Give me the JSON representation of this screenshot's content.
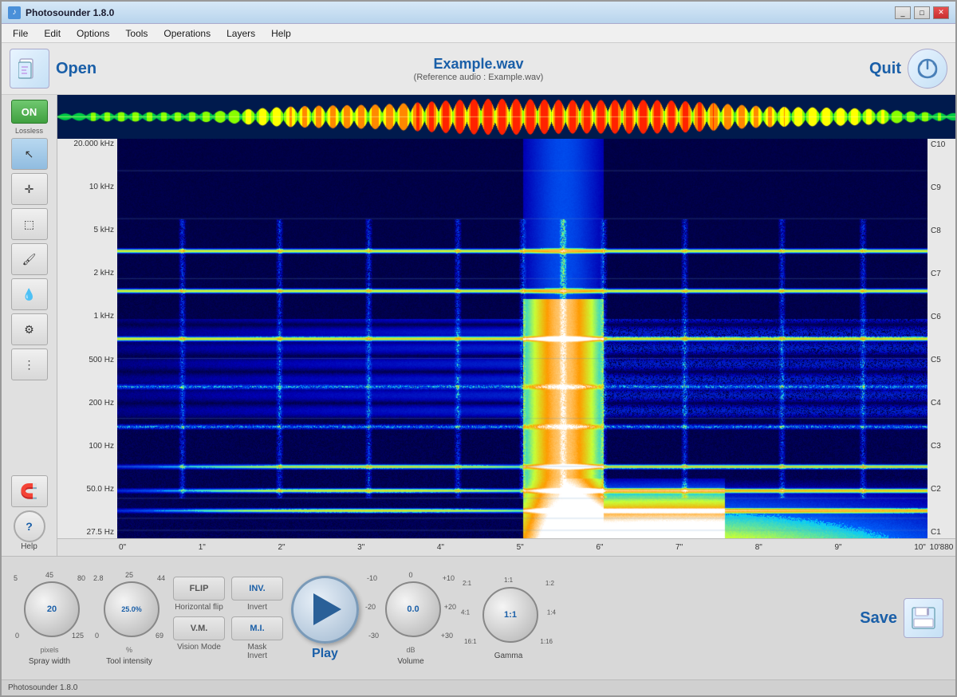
{
  "window": {
    "title": "Photosounder 1.8.0",
    "icon": "♪"
  },
  "menu": {
    "items": [
      "File",
      "Edit",
      "Options",
      "Tools",
      "Operations",
      "Layers",
      "Help"
    ]
  },
  "toolbar": {
    "open_label": "Open",
    "quit_label": "Quit",
    "file_title": "Example.wav",
    "file_subtitle": "(Reference audio : Example.wav)"
  },
  "freq_labels": [
    "20.000 kHz",
    "10 kHz",
    "5 kHz",
    "2 kHz",
    "1 kHz",
    "500 Hz",
    "200 Hz",
    "100 Hz",
    "50.0 Hz",
    "27.5 Hz"
  ],
  "note_labels": [
    "C10",
    "C9",
    "C8",
    "C7",
    "C6",
    "C5",
    "C4",
    "C3",
    "C2",
    "C1"
  ],
  "time_ticks": [
    "0\"",
    "1\"",
    "2\"",
    "3\"",
    "4\"",
    "5\"",
    "6\"",
    "7\"",
    "8\"",
    "9\"",
    "10\""
  ],
  "time_end": "10'880",
  "tools": {
    "on_label": "ON",
    "lossless_label": "Lossless"
  },
  "controls": {
    "spray_width": {
      "value": "20",
      "unit": "pixels",
      "label": "Spray width",
      "min": "0",
      "max": "180",
      "tick_top": "45",
      "tick_left": "5",
      "tick_right": "80",
      "tick_bl": "0",
      "tick_br": "125"
    },
    "tool_intensity": {
      "value": "25.0%",
      "unit": "%",
      "label": "Tool intensity",
      "min": "0",
      "max": "100",
      "tick_top": "25",
      "tick_left": "2.8",
      "tick_right": "44",
      "tick_bl": "0",
      "tick_br": "69"
    },
    "flip_label": "FLIP",
    "horiz_flip_label": "Horizontal flip",
    "invert_label": "INV.",
    "invert_full_label": "Invert",
    "vm_label": "V.M.",
    "vision_mode_label": "Vision Mode",
    "mi_label": "M.I.",
    "mask_invert_label": "Mask\nInvert",
    "play_label": "Play",
    "volume": {
      "value": "0.0",
      "unit": "dB",
      "label": "Volume",
      "tick_top": "0",
      "tick_tl": "-10",
      "tick_tr": "+10",
      "tick_left": "-20",
      "tick_right": "+20",
      "tick_bl": "-30",
      "tick_br": "+30"
    },
    "gamma": {
      "value": "1:1",
      "label": "Gamma",
      "tick_top": "1:1",
      "tick_tl": "2:1",
      "tick_tr": "1:2",
      "tick_left": "4:1",
      "tick_right": "1:4",
      "tick_bl": "16:1",
      "tick_br": "1:16"
    },
    "save_label": "Save"
  },
  "statusbar": {
    "text": "Photosounder 1.8.0"
  }
}
